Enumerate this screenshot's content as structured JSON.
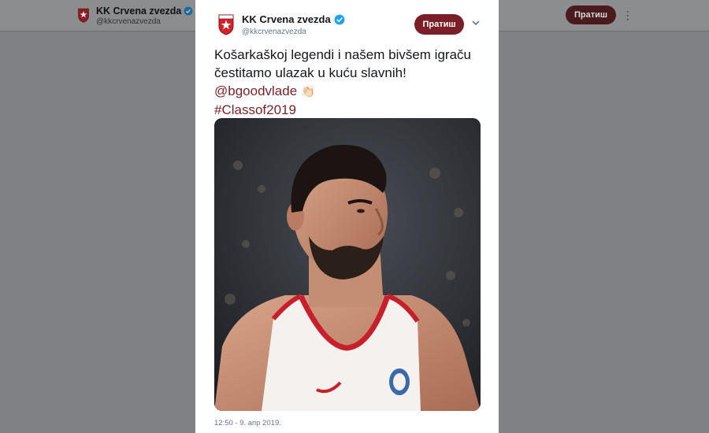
{
  "background": {
    "account_name": "KK Crvena zvezda",
    "handle": "@kkcrvenazvezda",
    "follow_label": "Пратиш",
    "more_icon": "more-vertical-icon"
  },
  "tweet": {
    "account_name": "KK Crvena zvezda",
    "handle": "@kkcrvenazvezda",
    "verified_icon": "verified-badge-icon",
    "follow_label": "Пратиш",
    "menu_icon": "chevron-down-icon",
    "text_line1": "Košarkaškoj legendi i našem bivšem igraču",
    "text_line2": "čestitamo ulazak u kuću slavnih!",
    "mention": "@bgoodvlade",
    "emoji": "👏🏻",
    "hashtag": "#Classof2019",
    "image": "photo-basketball-player",
    "timestamp": "12:50 - 9. апр 2019."
  },
  "colors": {
    "brand": "#7a1f27",
    "overlay": "#7f8184",
    "card": "#ffffff"
  }
}
